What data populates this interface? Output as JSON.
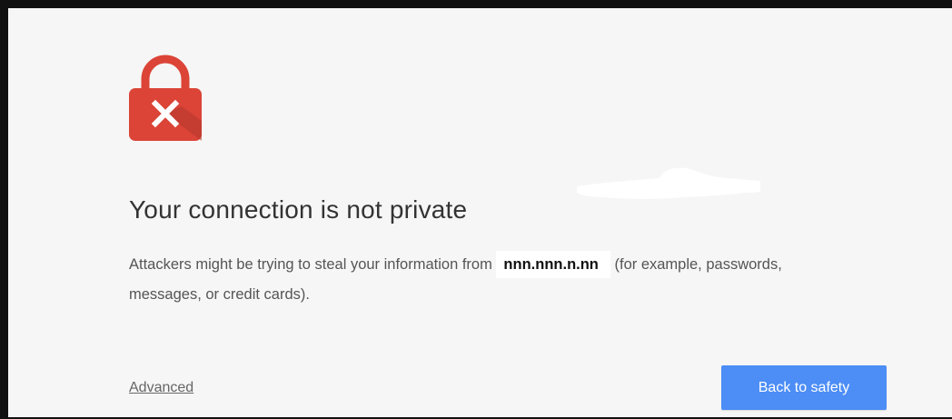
{
  "interstitial": {
    "title": "Your connection is not private",
    "description_before": "Attackers might be trying to steal your information from",
    "host": "nnn.nnn.n.nn",
    "description_after": "(for example, passwords, messages, or credit cards).",
    "advanced_link": "Advanced",
    "back_button": "Back to safety"
  },
  "icons": {
    "lock": "lock-x-icon"
  },
  "colors": {
    "lock_red": "#db4437",
    "lock_shadow": "#b3362b",
    "button_blue": "#4c8df6",
    "background": "#f6f6f6",
    "frame_border": "#111111"
  }
}
